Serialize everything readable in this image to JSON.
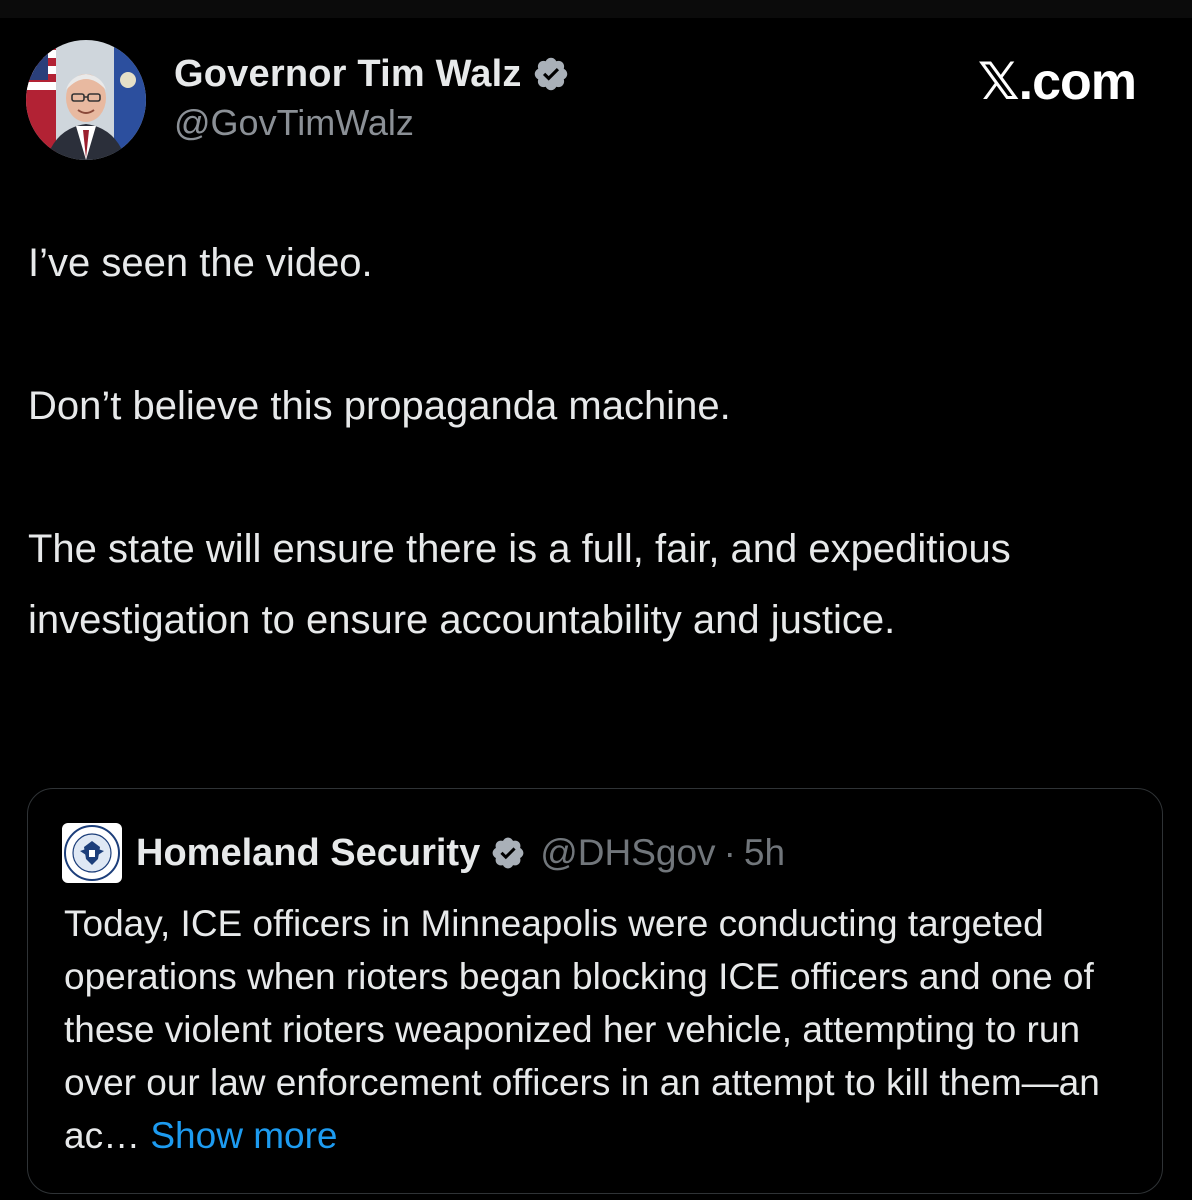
{
  "author": {
    "display_name": "Governor Tim Walz",
    "handle": "@GovTimWalz",
    "verified": true,
    "avatar_icon": "avatar-photo"
  },
  "brand": {
    "label": "𝕏.com"
  },
  "tweet": {
    "paragraphs": [
      "I’ve seen the video.",
      "Don’t believe this propaganda machine.",
      "The state will ensure there is a full, fair, and expeditious investigation to ensure accountability and justice."
    ]
  },
  "quoted": {
    "display_name": "Homeland Security",
    "handle": "@DHSgov",
    "separator": "·",
    "time": "5h",
    "verified": true,
    "logo_icon": "dhs-seal-icon",
    "text": "Today, ICE officers in Minneapolis were conducting targeted operations when rioters began blocking ICE officers and one of these violent rioters weaponized her vehicle, attempting to run over our law enforcement officers in an attempt to kill them—an ac… ",
    "show_more": "Show more"
  },
  "colors": {
    "background": "#000000",
    "text": "#e7e9ea",
    "secondary_text": "#71767b",
    "link": "#1d9bf0",
    "border": "#2f3336",
    "verified_badge": "#a9b0b8"
  }
}
